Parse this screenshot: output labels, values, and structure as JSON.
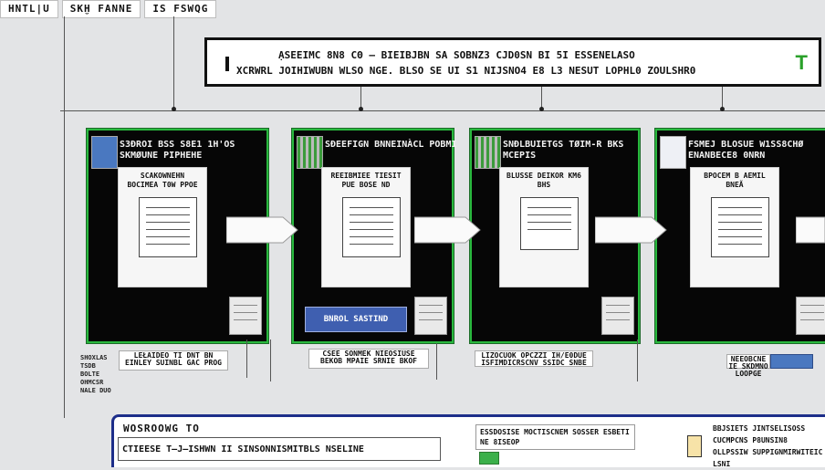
{
  "top_tabs": [
    "HNTL|U",
    "SKḪ FANNE",
    "IS FSWQG"
  ],
  "header": {
    "line1": "ẠSEEIMC 8N8 CΘ — BIEIBJBN SA SOBNZ3 CJD0SN BI 5I ESSENELASO",
    "line2": "XCRWRL JOIHIWUBN WLSO NGE. BLSO SE UI S1 NIJSNO4 E8 L3 NESUT LOPHL0 ZOULSHR0",
    "logo": "T"
  },
  "panels": [
    {
      "label": "S3ĐROI BSS S8E1 1H'OS SKMØUNE PIPHEHE",
      "doc_title": "SCAKOWNEHN BOCIMEA T0W PPOE",
      "cta": ""
    },
    {
      "label": "SĐEEFIGN BNNEINÀCL POBMI",
      "doc_title": "REEIBMIEE TIESIT PUE BOSE ND",
      "cta": "BNROL SASTIND"
    },
    {
      "label": "SNĐLBUIETGS TØIM-R BKS MCEPIS",
      "doc_title": "BLUSSE DEIKOR KM6 BHS",
      "cta": ""
    },
    {
      "label": "FSMEJ BLOSUE W1SS8CHØ ENANBECE8 0NRN",
      "doc_title": "BPOCEM B AEMIL BNEÃ",
      "cta": ""
    }
  ],
  "captions": [
    "LEŁAIDEO TI DNT BN EINLEY SUINBL GAC PROG",
    "CSEE SONMEK NIEOSIUSE BEKOB MPAIE SRNIE BKOF",
    "LIZOCUOK OPCZZI IH/E0DUE ISFIMDICRSCNV SSIDC SNBE",
    "NEEOBCNE IE SKDMNO LOOPGE"
  ],
  "side_note": "SHOXLAS TSDB BOLTE OHMCSR NALE DUO",
  "bottom": {
    "title": "WOSROOWG TO",
    "field": "CTIEESE T—J—ISHWN II SINSONNISMITBLS NSELINE",
    "mid_text": "ESSDOSISE MOCTISCNEM SOSSER ESBETI NE 8ISEOP",
    "right_text": "BBJSIETS JINTSELISOSS CUCMPCNS P8UNSIN8 OLLPSSIW SUPPIGNMIRWITEIC LSNI"
  },
  "colors": {
    "panel_border": "#29b83e",
    "panel_bg": "#060606",
    "accent_blue": "#3f5fb0",
    "frame_blue": "#1d2e8a",
    "logo_green": "#2aa02a"
  }
}
